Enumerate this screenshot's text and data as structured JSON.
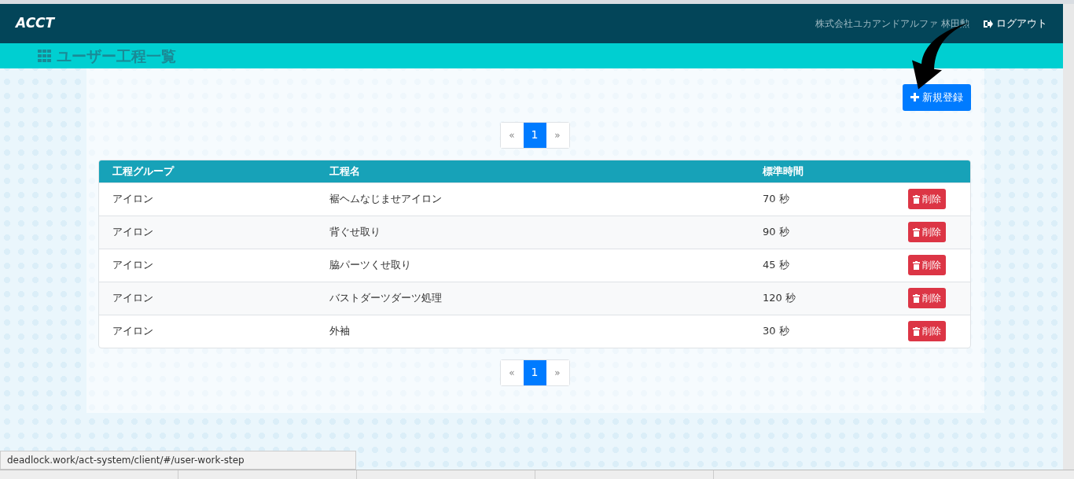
{
  "header": {
    "brand": "ACCT",
    "user": "株式会社ユカアンドアルファ 林田勲",
    "logout": "ログアウト"
  },
  "page_title": "ユーザー工程一覧",
  "new_button": "新規登録",
  "pagers": [
    {
      "items": [
        {
          "label": "«",
          "selected": false
        },
        {
          "label": "1",
          "selected": true
        },
        {
          "label": "»",
          "selected": false
        }
      ]
    },
    {
      "items": [
        {
          "label": "«",
          "selected": false
        },
        {
          "label": "1",
          "selected": true
        },
        {
          "label": "»",
          "selected": false
        }
      ]
    }
  ],
  "table": {
    "columns": [
      "工程グループ",
      "工程名",
      "標準時間"
    ],
    "rows": [
      {
        "group": "アイロン",
        "name": "裾ヘムなじませアイロン",
        "time": "70 秒",
        "action": "削除"
      },
      {
        "group": "アイロン",
        "name": "背ぐせ取り",
        "time": "90 秒",
        "action": "削除"
      },
      {
        "group": "アイロン",
        "name": "脇パーツくせ取り",
        "time": "45 秒",
        "action": "削除"
      },
      {
        "group": "アイロン",
        "name": "バストダーツダーツ処理",
        "time": "120 秒",
        "action": "削除"
      },
      {
        "group": "アイロン",
        "name": "外袖",
        "time": "30 秒",
        "action": "削除"
      }
    ]
  },
  "status_url": "deadlock.work/act-system/client/#/user-work-step"
}
